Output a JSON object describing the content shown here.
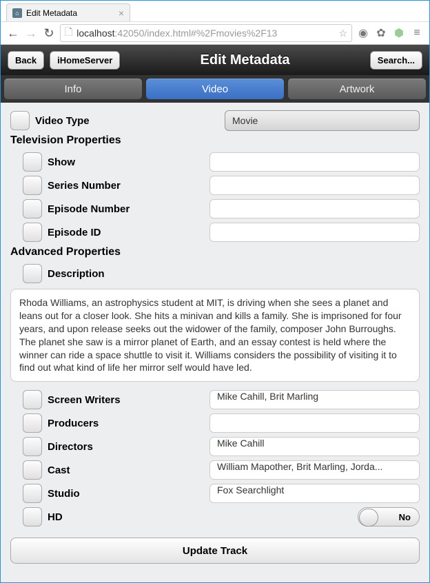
{
  "window": {
    "tab_title": "Edit Metadata",
    "url_host": "localhost",
    "url_rest": ":42050/index.html#%2Fmovies%2F13"
  },
  "header": {
    "back_label": "Back",
    "home_label": "iHomeServer",
    "title": "Edit Metadata",
    "search_label": "Search..."
  },
  "tabs": {
    "info": "Info",
    "video": "Video",
    "artwork": "Artwork"
  },
  "form": {
    "video_type_label": "Video Type",
    "video_type_value": "Movie",
    "tv_props_header": "Television Properties",
    "show_label": "Show",
    "show_value": "",
    "series_label": "Series Number",
    "series_value": "",
    "episode_num_label": "Episode Number",
    "episode_num_value": "",
    "episode_id_label": "Episode ID",
    "episode_id_value": "",
    "adv_props_header": "Advanced Properties",
    "description_label": "Description",
    "description_value": "Rhoda Williams, an astrophysics student at MIT, is driving when she sees a planet and leans out for a closer look. She hits a minivan and kills a family. She is imprisoned for four years, and upon release seeks out the widower of the family, composer John Burroughs. The planet she saw is a mirror planet of Earth, and an essay contest is held where the winner can ride a space shuttle to visit it. Williams considers the possibility of visiting it to find out what kind of life her mirror self would have led.",
    "screenwriters_label": "Screen Writers",
    "screenwriters_value": "Mike Cahill, Brit Marling",
    "producers_label": "Producers",
    "producers_value": "",
    "directors_label": "Directors",
    "directors_value": "Mike Cahill",
    "cast_label": "Cast",
    "cast_value": "William Mapother, Brit Marling, Jorda...",
    "studio_label": "Studio",
    "studio_value": "Fox Searchlight",
    "hd_label": "HD",
    "hd_value": "No",
    "update_label": "Update Track"
  }
}
